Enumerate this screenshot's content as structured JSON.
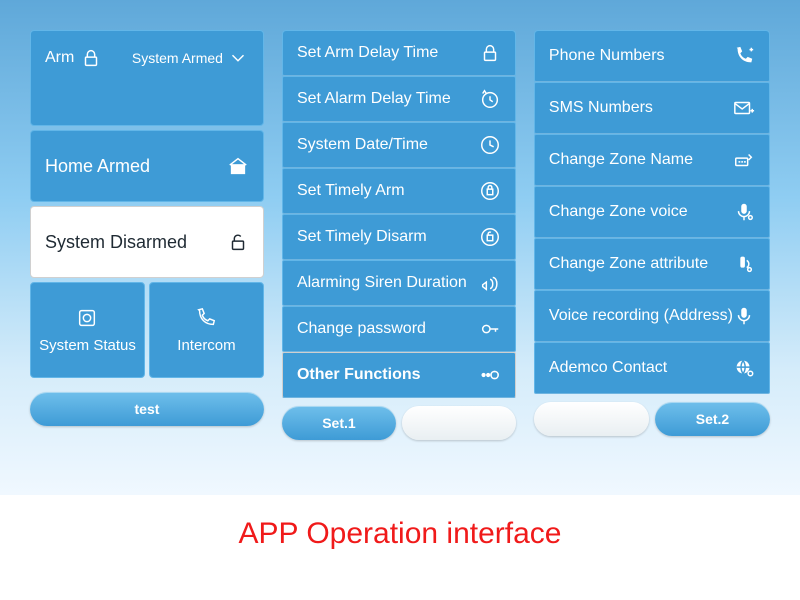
{
  "caption": "APP Operation interface",
  "left": {
    "arm_label": "Arm",
    "system_armed": "System Armed",
    "home_armed": "Home Armed",
    "system_disarmed": "System Disarmed",
    "system_status": "System Status",
    "intercom": "Intercom",
    "pill": "test"
  },
  "mid": {
    "items": [
      "Set Arm Delay Time",
      "Set Alarm Delay Time",
      "System Date/Time",
      "Set Timely Arm",
      "Set Timely Disarm",
      "Alarming Siren Duration",
      "Change password",
      "Other Functions"
    ],
    "pill_a": "Set.1",
    "pill_b": ""
  },
  "right": {
    "items": [
      "Phone Numbers",
      "SMS Numbers",
      "Change Zone Name",
      "Change Zone voice",
      "Change Zone attribute",
      "Voice recording (Address)",
      "Ademco Contact"
    ],
    "pill_a": "",
    "pill_b": "Set.2"
  }
}
